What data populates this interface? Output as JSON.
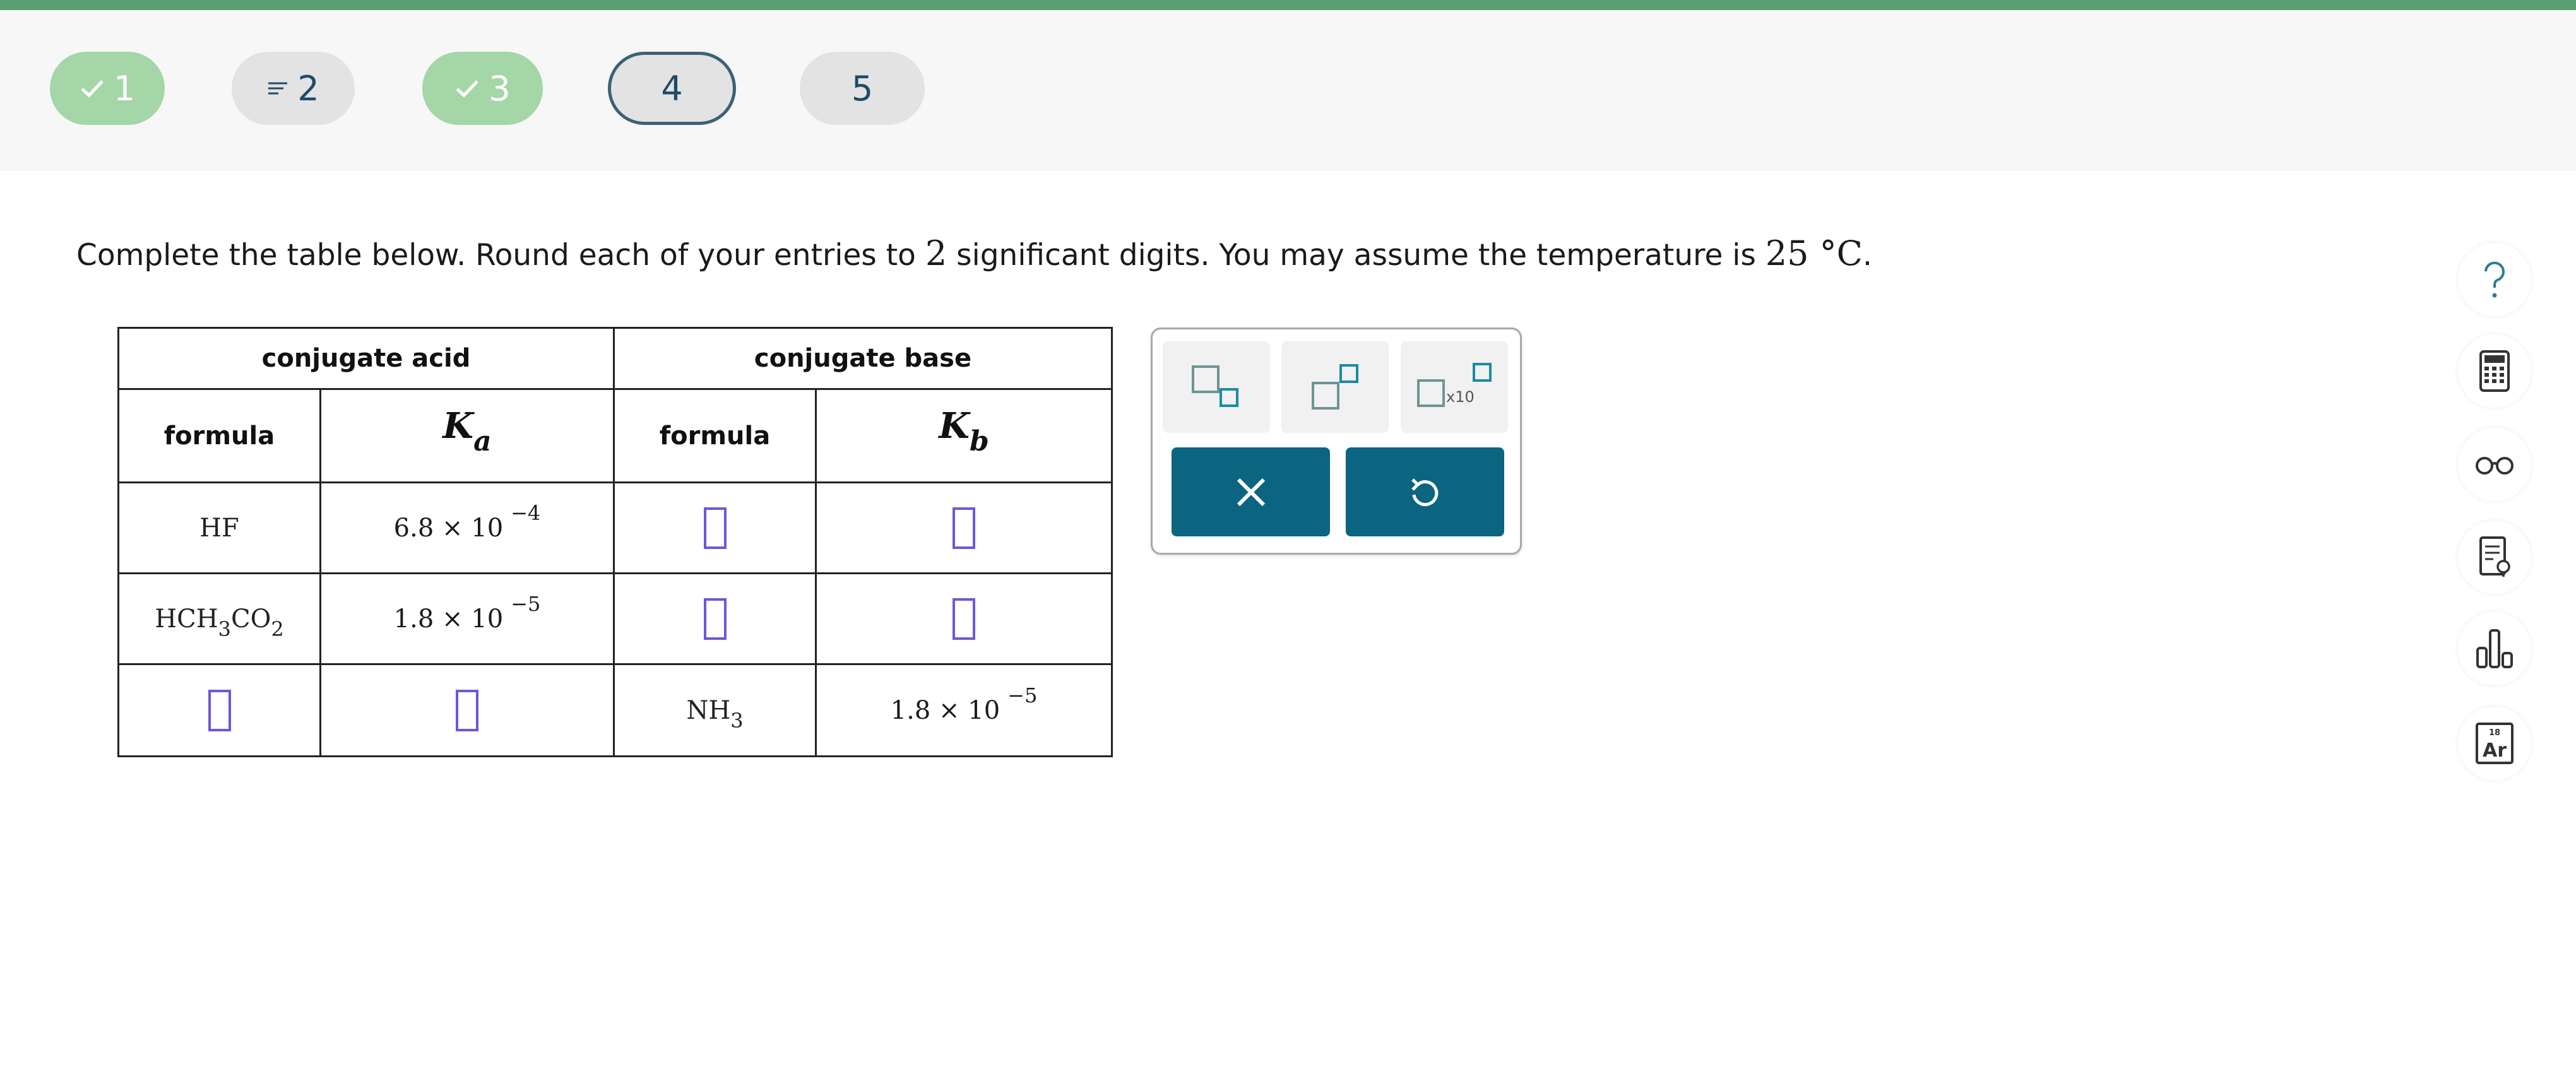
{
  "nav": {
    "steps": [
      {
        "label": "1",
        "status": "complete",
        "icon": "check-icon"
      },
      {
        "label": "2",
        "status": "partial",
        "icon": "lines-icon"
      },
      {
        "label": "3",
        "status": "complete",
        "icon": "check-icon"
      },
      {
        "label": "4",
        "status": "current"
      },
      {
        "label": "5",
        "status": "unanswered"
      }
    ],
    "colors": {
      "complete": "#a4d6a7",
      "bar": "#5a9e71",
      "current_border": "#3c6178"
    }
  },
  "question": {
    "text_a": "Complete the table below. Round each of your entries to ",
    "digits": "2",
    "text_b": " significant digits. You may assume the temperature is ",
    "temp": "25 °C",
    "text_c": "."
  },
  "table": {
    "acid_header": "conjugate acid",
    "base_header": "conjugate base",
    "formula_header": "formula",
    "ka_symbol": "K",
    "ka_sub": "a",
    "kb_symbol": "K",
    "kb_sub": "b",
    "times": "× 10",
    "rows": [
      {
        "acid_formula": "HF",
        "ka_mantissa": "6.8",
        "ka_exp": "−4"
      },
      {
        "acid_formula": "HCH",
        "acid_sub1": "3",
        "acid_mid": "CO",
        "acid_sub2": "2",
        "ka_mantissa": "1.8",
        "ka_exp": "−5"
      },
      {
        "base_formula": "NH",
        "base_sub": "3",
        "kb_mantissa": "1.8",
        "kb_exp": "−5"
      }
    ]
  },
  "palette": {
    "templates": [
      "subscript-template-icon",
      "superscript-template-icon",
      "scientific-notation-template-icon"
    ],
    "sci_label": "x10",
    "actions": [
      "clear-icon",
      "undo-icon"
    ],
    "accent": "#0b6480"
  },
  "tools": [
    "help-icon",
    "calculator-icon",
    "glasses-icon",
    "notes-icon",
    "bar-chart-icon",
    "periodic-table-icon"
  ],
  "periodic_element": {
    "number": "18",
    "symbol": "Ar"
  }
}
